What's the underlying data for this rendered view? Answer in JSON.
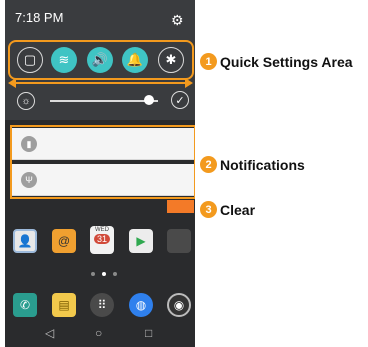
{
  "status_bar": {
    "time": "7:18 PM",
    "settings_icon": "gear-icon"
  },
  "quick_settings": {
    "toggles": [
      {
        "name": "qslide-icon",
        "state": "off",
        "glyph": "▢"
      },
      {
        "name": "wifi-icon",
        "state": "on",
        "glyph": "≋"
      },
      {
        "name": "sound-icon",
        "state": "on",
        "glyph": "🔊"
      },
      {
        "name": "notification-icon",
        "state": "on",
        "glyph": "🔔"
      },
      {
        "name": "bluetooth-icon",
        "state": "off",
        "glyph": "✱"
      }
    ],
    "brightness_level": 0.92,
    "auto_brightness_glyph": "✓"
  },
  "notifications": [
    {
      "icon": "battery-icon",
      "glyph": "▮"
    },
    {
      "icon": "usb-icon",
      "glyph": "Ψ"
    }
  ],
  "home": {
    "apps": [
      "contacts",
      "email",
      "calendar",
      "play-store",
      "google-apps"
    ],
    "calendar_day": "WED",
    "calendar_date": "31",
    "dock": [
      "phone",
      "messaging",
      "apps",
      "internet",
      "camera"
    ]
  },
  "nav_bar": {
    "back": "◁",
    "home": "○",
    "recent": "□"
  },
  "callouts": [
    {
      "number": "1",
      "label": "Quick Settings Area"
    },
    {
      "number": "2",
      "label": "Notifications"
    },
    {
      "number": "3",
      "label": "Clear"
    }
  ],
  "colors": {
    "accent": "#f39a1e",
    "toggle_on": "#3fc4c4",
    "clear": "#f37a28"
  }
}
